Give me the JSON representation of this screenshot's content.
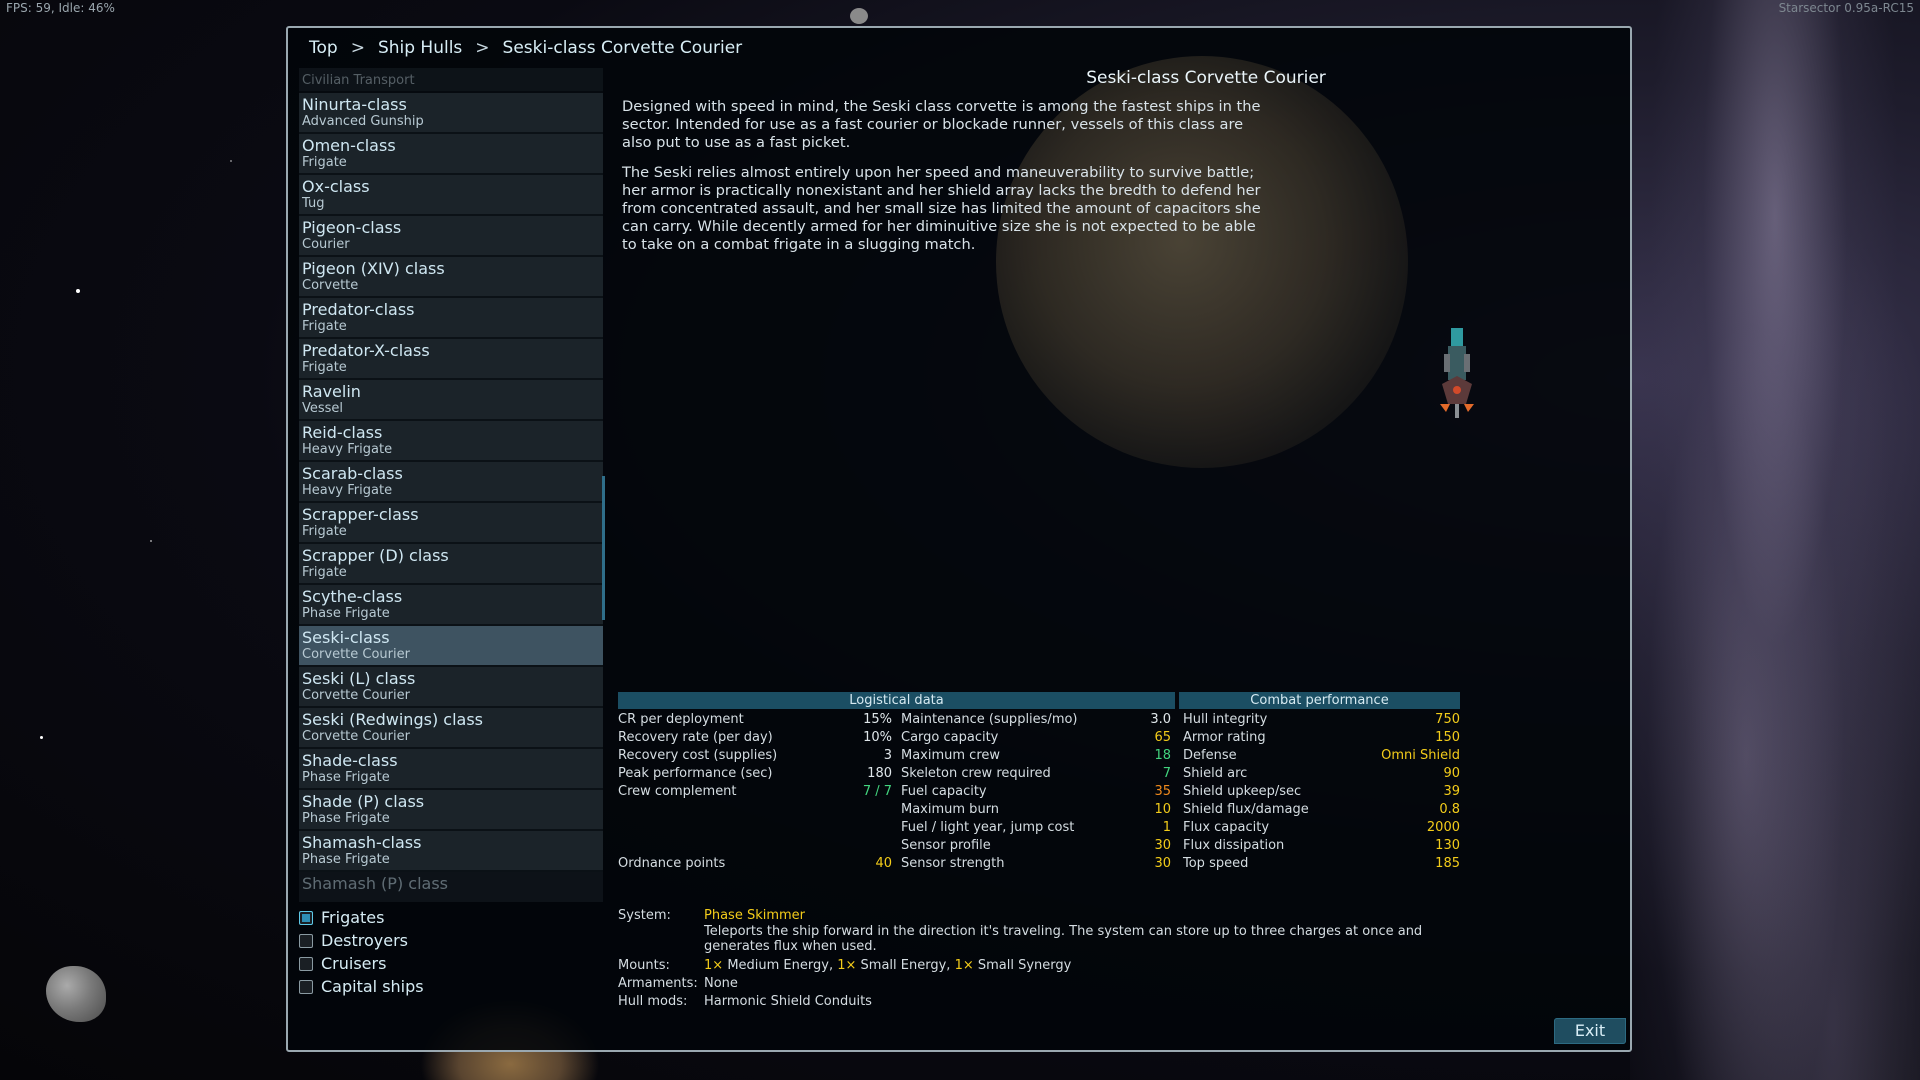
{
  "hud": {
    "fps": "FPS: 59, Idle: 46%",
    "version": "Starsector 0.95a-RC15"
  },
  "breadcrumb": {
    "items": [
      "Top",
      "Ship Hulls",
      "Seski-class Corvette Courier"
    ],
    "separator": ">"
  },
  "ship_list": [
    {
      "name": "",
      "sub": "Civilian Transport"
    },
    {
      "name": "Ninurta-class",
      "sub": "Advanced Gunship"
    },
    {
      "name": "Omen-class",
      "sub": "Frigate"
    },
    {
      "name": "Ox-class",
      "sub": "Tug"
    },
    {
      "name": "Pigeon-class",
      "sub": "Courier"
    },
    {
      "name": "Pigeon (XIV) class",
      "sub": "Corvette"
    },
    {
      "name": "Predator-class",
      "sub": "Frigate"
    },
    {
      "name": "Predator-X-class",
      "sub": "Frigate"
    },
    {
      "name": "Ravelin",
      "sub": "Vessel"
    },
    {
      "name": "Reid-class",
      "sub": "Heavy Frigate"
    },
    {
      "name": "Scarab-class",
      "sub": "Heavy Frigate"
    },
    {
      "name": "Scrapper-class",
      "sub": "Frigate"
    },
    {
      "name": "Scrapper (D) class",
      "sub": "Frigate"
    },
    {
      "name": "Scythe-class",
      "sub": "Phase Frigate"
    },
    {
      "name": "Seski-class",
      "sub": "Corvette Courier"
    },
    {
      "name": "Seski (L) class",
      "sub": "Corvette Courier"
    },
    {
      "name": "Seski (Redwings) class",
      "sub": "Corvette Courier"
    },
    {
      "name": "Shade-class",
      "sub": "Phase Frigate"
    },
    {
      "name": "Shade (P) class",
      "sub": "Phase Frigate"
    },
    {
      "name": "Shamash-class",
      "sub": "Phase Frigate"
    },
    {
      "name": "Shamash (P) class",
      "sub": ""
    }
  ],
  "selected_index": 14,
  "filters": [
    {
      "label": "Frigates",
      "checked": true
    },
    {
      "label": "Destroyers",
      "checked": false
    },
    {
      "label": "Cruisers",
      "checked": false
    },
    {
      "label": "Capital ships",
      "checked": false
    }
  ],
  "detail": {
    "title": "Seski-class Corvette Courier",
    "description": [
      "Designed with speed in mind, the Seski class corvette is among the fastest ships in the sector.  Intended for use as a fast courier or blockade runner, vessels of this class are also put to use as a fast picket.",
      "The Seski relies almost entirely upon her speed and maneuverability to survive battle; her armor is practically nonexistant and her shield array lacks the bredth to defend her from concentrated assault, and her small size has limited the amount of capacitors she can carry.  While decently armed for her diminuitive size she is not expected to be able to take on a combat frigate in a slugging match."
    ]
  },
  "stats": {
    "logistical_header": "Logistical data",
    "combat_header": "Combat performance",
    "col1": [
      {
        "k": "CR per deployment",
        "v": "15%",
        "c": "wht"
      },
      {
        "k": " Recovery rate (per day)",
        "v": "10%",
        "c": "wht"
      },
      {
        "k": " Recovery cost (supplies)",
        "v": "3",
        "c": "wht"
      },
      {
        "k": "Peak performance (sec)",
        "v": "180",
        "c": "wht"
      },
      {
        "k": "Crew complement",
        "v": "7 / 7",
        "c": "grn"
      },
      {
        "k": "",
        "v": "",
        "c": "wht"
      },
      {
        "k": "",
        "v": "",
        "c": "wht"
      },
      {
        "k": "",
        "v": "",
        "c": "wht"
      },
      {
        "k": "Ordnance points",
        "v": "40",
        "c": "yel"
      }
    ],
    "col2": [
      {
        "k": "Maintenance (supplies/mo)",
        "v": "3.0",
        "c": "wht"
      },
      {
        "k": "Cargo capacity",
        "v": "65",
        "c": "yel"
      },
      {
        "k": "Maximum crew",
        "v": "18",
        "c": "grn"
      },
      {
        "k": "Skeleton crew required",
        "v": "7",
        "c": "grn"
      },
      {
        "k": "Fuel capacity",
        "v": "35",
        "c": "org"
      },
      {
        "k": "Maximum burn",
        "v": "10",
        "c": "yel"
      },
      {
        "k": "Fuel / light year, jump cost",
        "v": "1",
        "c": "yel"
      },
      {
        "k": "Sensor profile",
        "v": "30",
        "c": "yel"
      },
      {
        "k": "Sensor strength",
        "v": "30",
        "c": "yel"
      }
    ],
    "col3": [
      {
        "k": "Hull integrity",
        "v": "750",
        "c": "yel"
      },
      {
        "k": "Armor rating",
        "v": "150",
        "c": "yel"
      },
      {
        "k": "Defense",
        "v": "Omni Shield",
        "c": "yel"
      },
      {
        "k": "Shield arc",
        "v": "90",
        "c": "yel"
      },
      {
        "k": "Shield upkeep/sec",
        "v": "39",
        "c": "yel"
      },
      {
        "k": "Shield flux/damage",
        "v": "0.8",
        "c": "yel"
      },
      {
        "k": "Flux capacity",
        "v": "2000",
        "c": "yel"
      },
      {
        "k": "Flux dissipation",
        "v": "130",
        "c": "yel"
      },
      {
        "k": "Top speed",
        "v": "185",
        "c": "yel"
      }
    ]
  },
  "system": {
    "system_label": "System:",
    "system_name": "Phase Skimmer",
    "system_desc": "Teleports the ship forward in the direction it's traveling. The system can store up to three charges at once and generates flux when used.",
    "mounts_label": "Mounts:",
    "mounts": [
      {
        "count": "1×",
        "text": "Medium Energy,"
      },
      {
        "count": "1×",
        "text": "Small Energy,"
      },
      {
        "count": "1×",
        "text": "Small Synergy"
      }
    ],
    "armaments_label": "Armaments:",
    "armaments": "None",
    "hullmods_label": "Hull mods:",
    "hullmods": "Harmonic Shield Conduits"
  },
  "exit_label": "Exit"
}
